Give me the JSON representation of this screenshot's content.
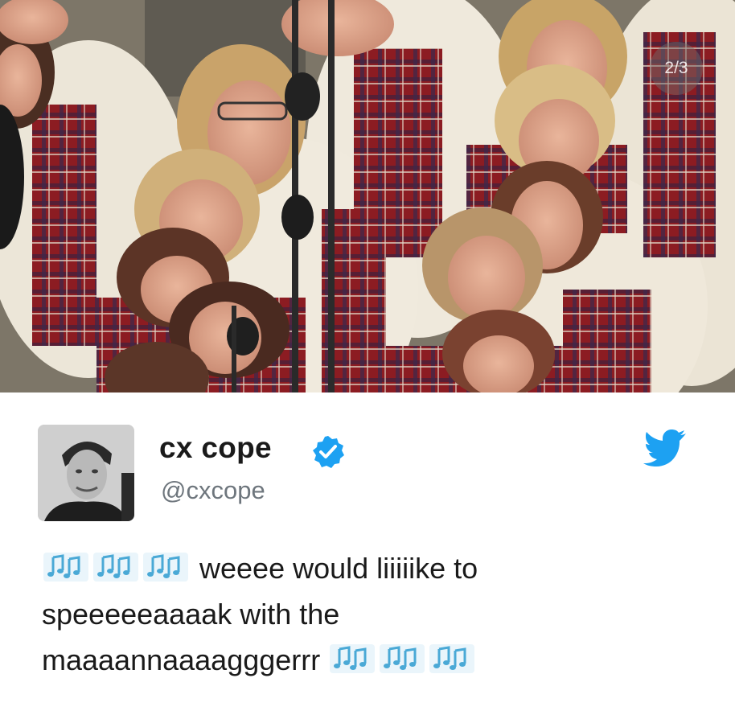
{
  "photo": {
    "page_indicator": "2/3"
  },
  "tweet": {
    "display_name": "cx cope",
    "handle": "@cxcope",
    "verified": true,
    "avatar_icon": "user-avatar-photo",
    "bird_icon": "twitter-bird-icon",
    "text": {
      "line1_prefix_icons": [
        "music-notes-icon",
        "music-notes-icon",
        "music-notes-icon"
      ],
      "line1_text": " weeee would liiiiike to",
      "line2_text": "speeeeeaaaak with the",
      "line3_text": "maaaannaaaagggerrr ",
      "line3_suffix_icons": [
        "music-notes-icon",
        "music-notes-icon",
        "music-notes-icon"
      ]
    },
    "timestamp": "",
    "colors": {
      "brand_blue": "#1da1f2",
      "verified_blue": "#1da1f2",
      "text": "#1a1a1a",
      "muted": "#6e767d"
    }
  }
}
